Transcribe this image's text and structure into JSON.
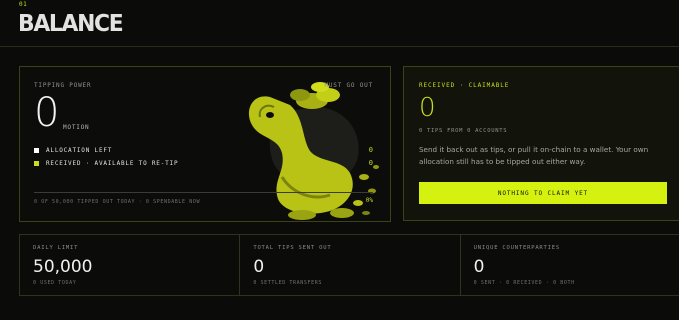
{
  "section": {
    "number": "01",
    "title": "BALANCE"
  },
  "tipping_power": {
    "label": "TIPPING POWER",
    "must_go_out": "MUST GO OUT",
    "value": "0",
    "unit": "MOTION",
    "legend": [
      {
        "label": "ALLOCATION LEFT",
        "value": "0",
        "color": "#ffffff"
      },
      {
        "label": "RECEIVED · AVAILABLE TO RE-TIP",
        "value": "0",
        "color": "#c9dc1e"
      }
    ],
    "progress": 0,
    "footnote": "0 OF 50,000 TIPPED OUT TODAY · 0 SPENDABLE NOW",
    "foot_value": "0%"
  },
  "received": {
    "label": "RECEIVED · CLAIMABLE",
    "value": "0",
    "tips_line": "0 TIPS FROM 0 ACCOUNTS",
    "description": "Send it back out as tips, or pull it on-chain to a wallet. Your own allocation still has to be tipped out either way.",
    "button_label": "NOTHING TO CLAIM YET"
  },
  "stats": [
    {
      "label": "DAILY LIMIT",
      "value": "50,000",
      "sub": "0 USED TODAY"
    },
    {
      "label": "TOTAL TIPS SENT OUT",
      "value": "0",
      "sub": "0 SETTLED TRANSFERS"
    },
    {
      "label": "UNIQUE COUNTERPARTIES",
      "value": "0",
      "sub": "0 SENT · 0 RECEIVED · 0 BOTH"
    }
  ],
  "colors": {
    "accent": "#c9dc1e",
    "button": "#d4f10f",
    "background": "#0b0c09"
  },
  "illustration": "yellow-creature-carrying-sack-of-coins"
}
